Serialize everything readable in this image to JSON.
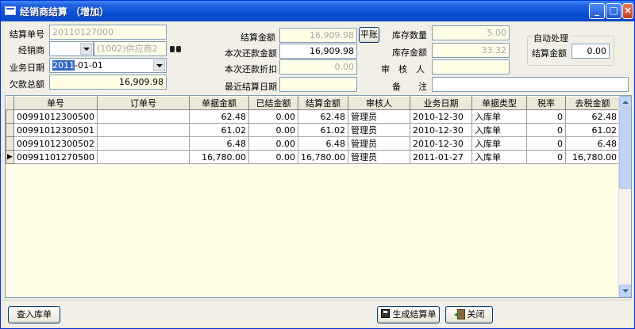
{
  "window": {
    "title": "经销商结算 （增加）",
    "buttons": {
      "minimize": "_",
      "maximize": "□",
      "close": "×"
    }
  },
  "form": {
    "settle_no": {
      "label": "结算单号",
      "value": "20110127000"
    },
    "dealer": {
      "label": "经销商",
      "value": "",
      "name_value": "(1002)供应商2"
    },
    "biz_date": {
      "label": "业务日期",
      "value_selected": "2011",
      "value_rest": "-01-01"
    },
    "owed_total": {
      "label": "欠款总额",
      "value": "16,909.98"
    },
    "settle_amount": {
      "label": "结算金额",
      "value": "16,909.98"
    },
    "balance_button": "平账",
    "repay_amount": {
      "label": "本次还款金额",
      "value": "16,909.98"
    },
    "repay_discount": {
      "label": "本次还款折扣",
      "value": "0.00"
    },
    "last_settle_date": {
      "label": "最近结算日期",
      "value": ""
    },
    "stock_qty": {
      "label": "库存数量",
      "value": "5.00"
    },
    "stock_amount": {
      "label": "库存金额",
      "value": "33.32"
    },
    "auditor": {
      "label": "审　核　人",
      "value": ""
    },
    "remark": {
      "label": "备　　注",
      "value": ""
    },
    "auto_group": {
      "title": "自动处理",
      "label": "结算金额",
      "value": "0.00"
    }
  },
  "grid": {
    "columns": [
      "单号",
      "订单号",
      "单据金额",
      "已结金额",
      "结算金额",
      "审核人",
      "业务日期",
      "单据类型",
      "税率",
      "去税金额"
    ],
    "rows": [
      {
        "current": false,
        "cells": [
          "00991012300500",
          "",
          "62.48",
          "0.00",
          "62.48",
          "管理员",
          "2010-12-30",
          "入库单",
          "0",
          "62.48"
        ]
      },
      {
        "current": false,
        "cells": [
          "00991012300501",
          "",
          "61.02",
          "0.00",
          "61.02",
          "管理员",
          "2010-12-30",
          "入库单",
          "0",
          "61.02"
        ]
      },
      {
        "current": false,
        "cells": [
          "00991012300502",
          "",
          "6.48",
          "0.00",
          "6.48",
          "管理员",
          "2010-12-30",
          "入库单",
          "0",
          "6.48"
        ]
      },
      {
        "current": true,
        "cells": [
          "00991101270500",
          "",
          "16,780.00",
          "0.00",
          "16,780.00",
          "管理员",
          "2011-01-27",
          "入库单",
          "0",
          "16,780.00"
        ]
      }
    ],
    "current_row_marker": "▶"
  },
  "footer": {
    "query_button": "查入库单",
    "generate_button": "生成结算单",
    "close_button": "关闭"
  }
}
